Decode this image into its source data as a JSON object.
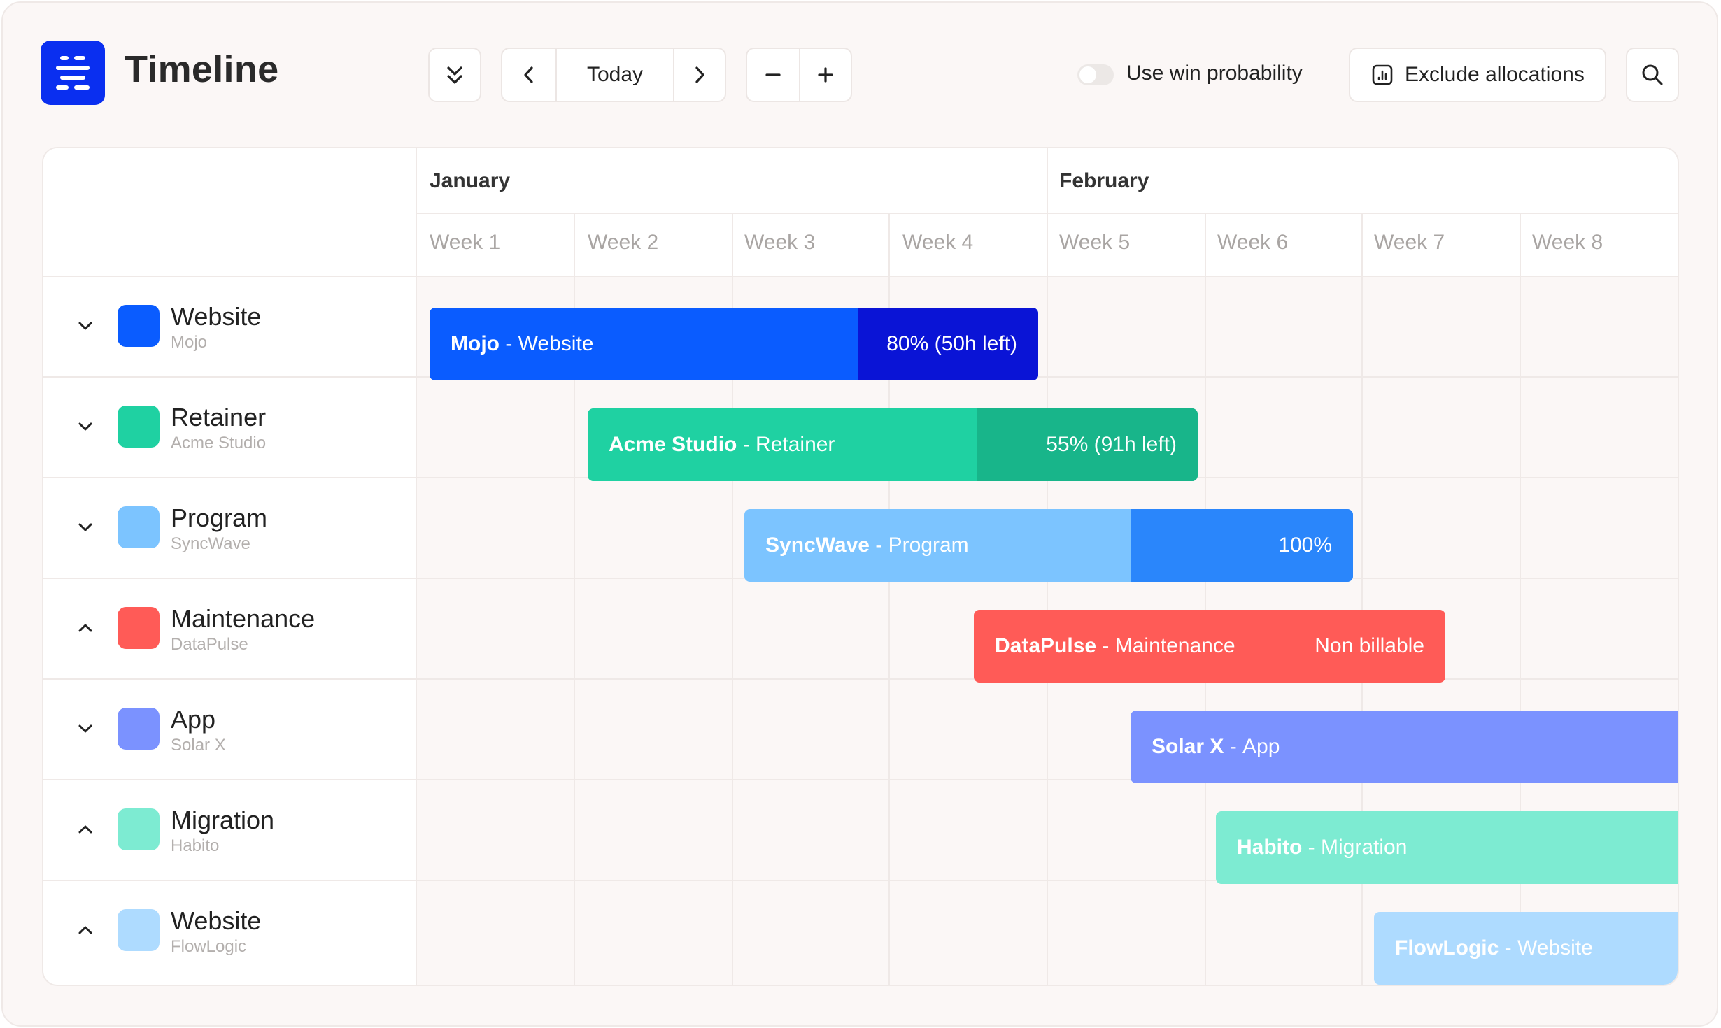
{
  "header": {
    "title": "Timeline",
    "today_label": "Today",
    "win_probability_label": "Use win probability",
    "exclude_allocations_label": "Exclude allocations"
  },
  "timeline": {
    "months": [
      {
        "label": "January"
      },
      {
        "label": "February"
      }
    ],
    "weeks": [
      "Week 1",
      "Week 2",
      "Week 3",
      "Week 4",
      "Week 5",
      "Week 6",
      "Week 7",
      "Week 8"
    ]
  },
  "rows": [
    {
      "name": "Website",
      "client": "Mojo",
      "color": "#0a5cff",
      "expanded": false,
      "task": {
        "client": "Mojo",
        "project": "Website",
        "progress_text": "80% (50h left)",
        "color": "#0a5cff",
        "progress_color": "#0a14d6"
      }
    },
    {
      "name": "Retainer",
      "client": "Acme Studio",
      "color": "#1fd1a2",
      "expanded": false,
      "task": {
        "client": "Acme Studio",
        "project": "Retainer",
        "progress_text": "55% (91h left)",
        "color": "#1fd1a2",
        "progress_color": "#18b58a"
      }
    },
    {
      "name": "Program",
      "client": "SyncWave",
      "color": "#7cc4ff",
      "expanded": false,
      "task": {
        "client": "SyncWave",
        "project": "Program",
        "progress_text": "100%",
        "color": "#7cc4ff",
        "progress_color": "#2a86fb"
      }
    },
    {
      "name": "Maintenance",
      "client": "DataPulse",
      "color": "#ff5b57",
      "expanded": true,
      "task": {
        "client": "DataPulse",
        "project": "Maintenance",
        "right_text": "Non billable",
        "color": "#ff5b57"
      }
    },
    {
      "name": "App",
      "client": "Solar X",
      "color": "#7b92ff",
      "expanded": false,
      "task": {
        "client": "Solar X",
        "project": "App",
        "color": "#7b92ff"
      }
    },
    {
      "name": "Migration",
      "client": "Habito",
      "color": "#7debd2",
      "expanded": true,
      "task": {
        "client": "Habito",
        "project": "Migration",
        "color": "#7debd2"
      }
    },
    {
      "name": "Website",
      "client": "FlowLogic",
      "color": "#aedbff",
      "expanded": true,
      "task": {
        "client": "FlowLogic",
        "project": "Website",
        "color": "#aedbff"
      }
    }
  ],
  "separator": " - "
}
